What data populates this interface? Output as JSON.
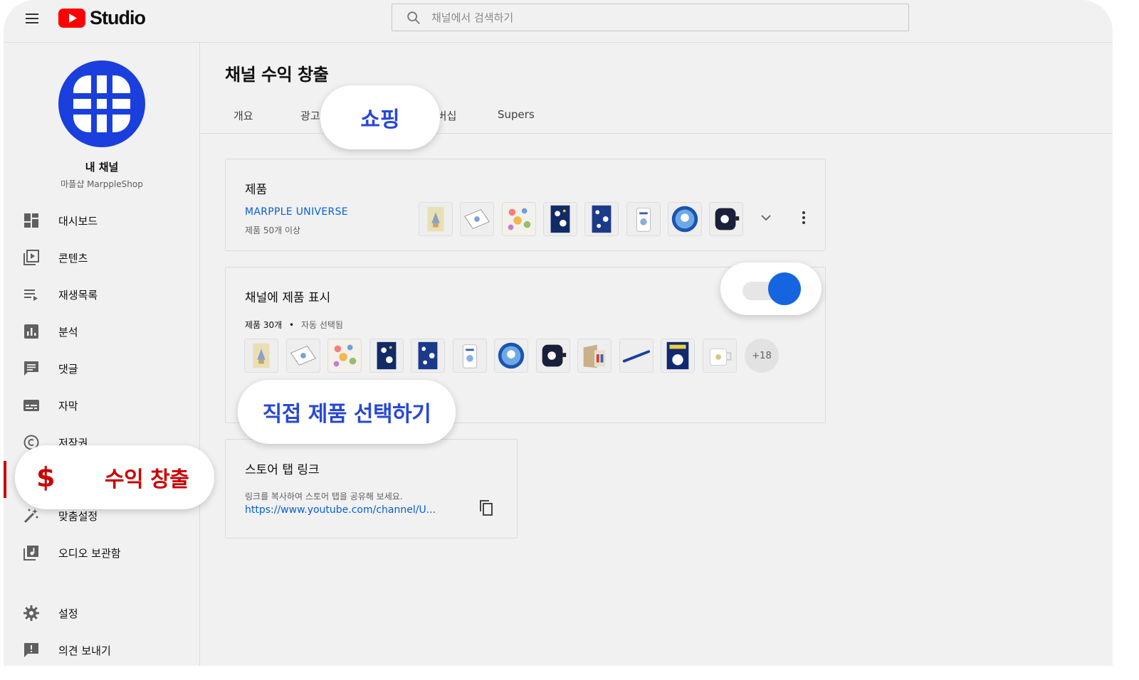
{
  "app": {
    "logo_text": "Studio"
  },
  "search": {
    "placeholder": "채널에서 검색하기"
  },
  "channel": {
    "name": "내 채널",
    "subtitle": "마플샵 MarppleShop"
  },
  "sidebar": {
    "items": [
      {
        "label": "대시보드",
        "icon": "dashboard-icon"
      },
      {
        "label": "콘텐츠",
        "icon": "content-icon"
      },
      {
        "label": "재생목록",
        "icon": "playlist-icon"
      },
      {
        "label": "분석",
        "icon": "analytics-icon"
      },
      {
        "label": "댓글",
        "icon": "comments-icon"
      },
      {
        "label": "자막",
        "icon": "subtitles-icon"
      },
      {
        "label": "저작권",
        "icon": "copyright-icon"
      },
      {
        "label": "맞춤설정",
        "icon": "customize-icon"
      },
      {
        "label": "오디오 보관함",
        "icon": "audio-library-icon"
      },
      {
        "label": "설정",
        "icon": "settings-icon"
      },
      {
        "label": "의견 보내기",
        "icon": "feedback-icon"
      }
    ],
    "active_callout": {
      "symbol": "$",
      "label": "수익 창출"
    }
  },
  "page": {
    "title": "채널 수익 창출"
  },
  "tabs": [
    {
      "label": "개요"
    },
    {
      "label": "광고"
    },
    {
      "label": "멤버십"
    },
    {
      "label": "Supers"
    }
  ],
  "tab_callout": {
    "label": "쇼핑"
  },
  "products_card": {
    "title": "제품",
    "store_name": "MARPPLE UNIVERSE",
    "store_count": "제품 50개 이상"
  },
  "display_card": {
    "title": "채널에 제품 표시",
    "count": "제품 30개",
    "separator": "•",
    "mode": "자동 선택됨",
    "more_count": "+18",
    "toggle_on": true,
    "callout": "직접 제품 선택하기"
  },
  "store_tab_card": {
    "title": "스토어 탭 링크",
    "description": "링크를 복사하여 스토어 탭을 공유해 보세요.",
    "link": "https://www.youtube.com/channel/U..."
  },
  "colors": {
    "brand_red": "#ff0000",
    "active_red": "#cc0000",
    "accent_blue": "#065fd4",
    "toggle_blue": "#1565e0",
    "callout_blue": "#2748d6",
    "avatar_blue": "#1a3fdc"
  }
}
